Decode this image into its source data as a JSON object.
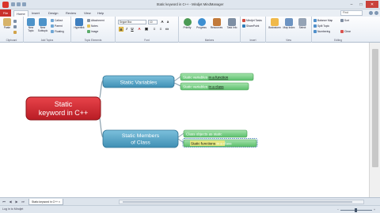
{
  "app": {
    "title": "Static keyword in C++ - Mindjet MindManager",
    "accent": "#c9302c"
  },
  "ribbon_tabs": [
    "File",
    "Home",
    "Insert",
    "Design",
    "Review",
    "View",
    "Help"
  ],
  "search": {
    "placeholder": "Find"
  },
  "ribbon_groups": {
    "clipboard": {
      "label": "Clipboard",
      "paste": "Paste"
    },
    "add_topics": {
      "label": "Add Topics",
      "new_topic": "New Topic",
      "new_subtopic": "New Subtopic",
      "callout": "Callout",
      "parent": "Parent",
      "floating": "Floating"
    },
    "topic_elements": {
      "label": "Topic Elements",
      "hyperlink": "Hyperlink",
      "attachment": "Attachment",
      "notes": "Notes",
      "image": "Image"
    },
    "font": {
      "label": "Font",
      "family": "Segoe Bra",
      "size": "10"
    },
    "markers": {
      "label": "Markers",
      "priority": "Priority",
      "progress": "Progress",
      "resources": "Resources",
      "task": "Task Info"
    },
    "insert": {
      "label": "Insert",
      "mindjet_tasks": "Mindjet Tasks",
      "sharepoint": "SharePoint"
    },
    "view": {
      "label": "View",
      "brainstorm": "Brainstorm",
      "map_index": "Map Index",
      "select": "Select"
    },
    "editing": {
      "label": "Editing",
      "balance_map": "Balance Map",
      "split_topic": "Split Topic",
      "numbering": "Numbering",
      "sort": "Sort",
      "clear": "Clear"
    }
  },
  "mindmap": {
    "central": {
      "line1": "Static",
      "line2": "keyword in C++",
      "color": "#d8262e"
    },
    "main_topics": [
      {
        "label": "Static Variables",
        "color": "#5ba8c9"
      },
      {
        "line1": "Static Members",
        "line2": "of Class",
        "color": "#5ba8c9"
      }
    ],
    "subtopics": [
      {
        "label_start": "Static variables",
        "label_highlight": "in a function"
      },
      {
        "label_start": "Static variables",
        "label_highlight": "in a class"
      },
      {
        "label_start": "Class objects as static",
        "label_highlight": ""
      },
      {
        "label_start": "Static functions",
        "label_highlight": "in a class"
      }
    ],
    "subtopic_color": "#7fcf8a"
  },
  "document_tab": {
    "label": "Static keyword in C++",
    "close": "×"
  },
  "status": {
    "text": "Log in to Mindjet"
  }
}
